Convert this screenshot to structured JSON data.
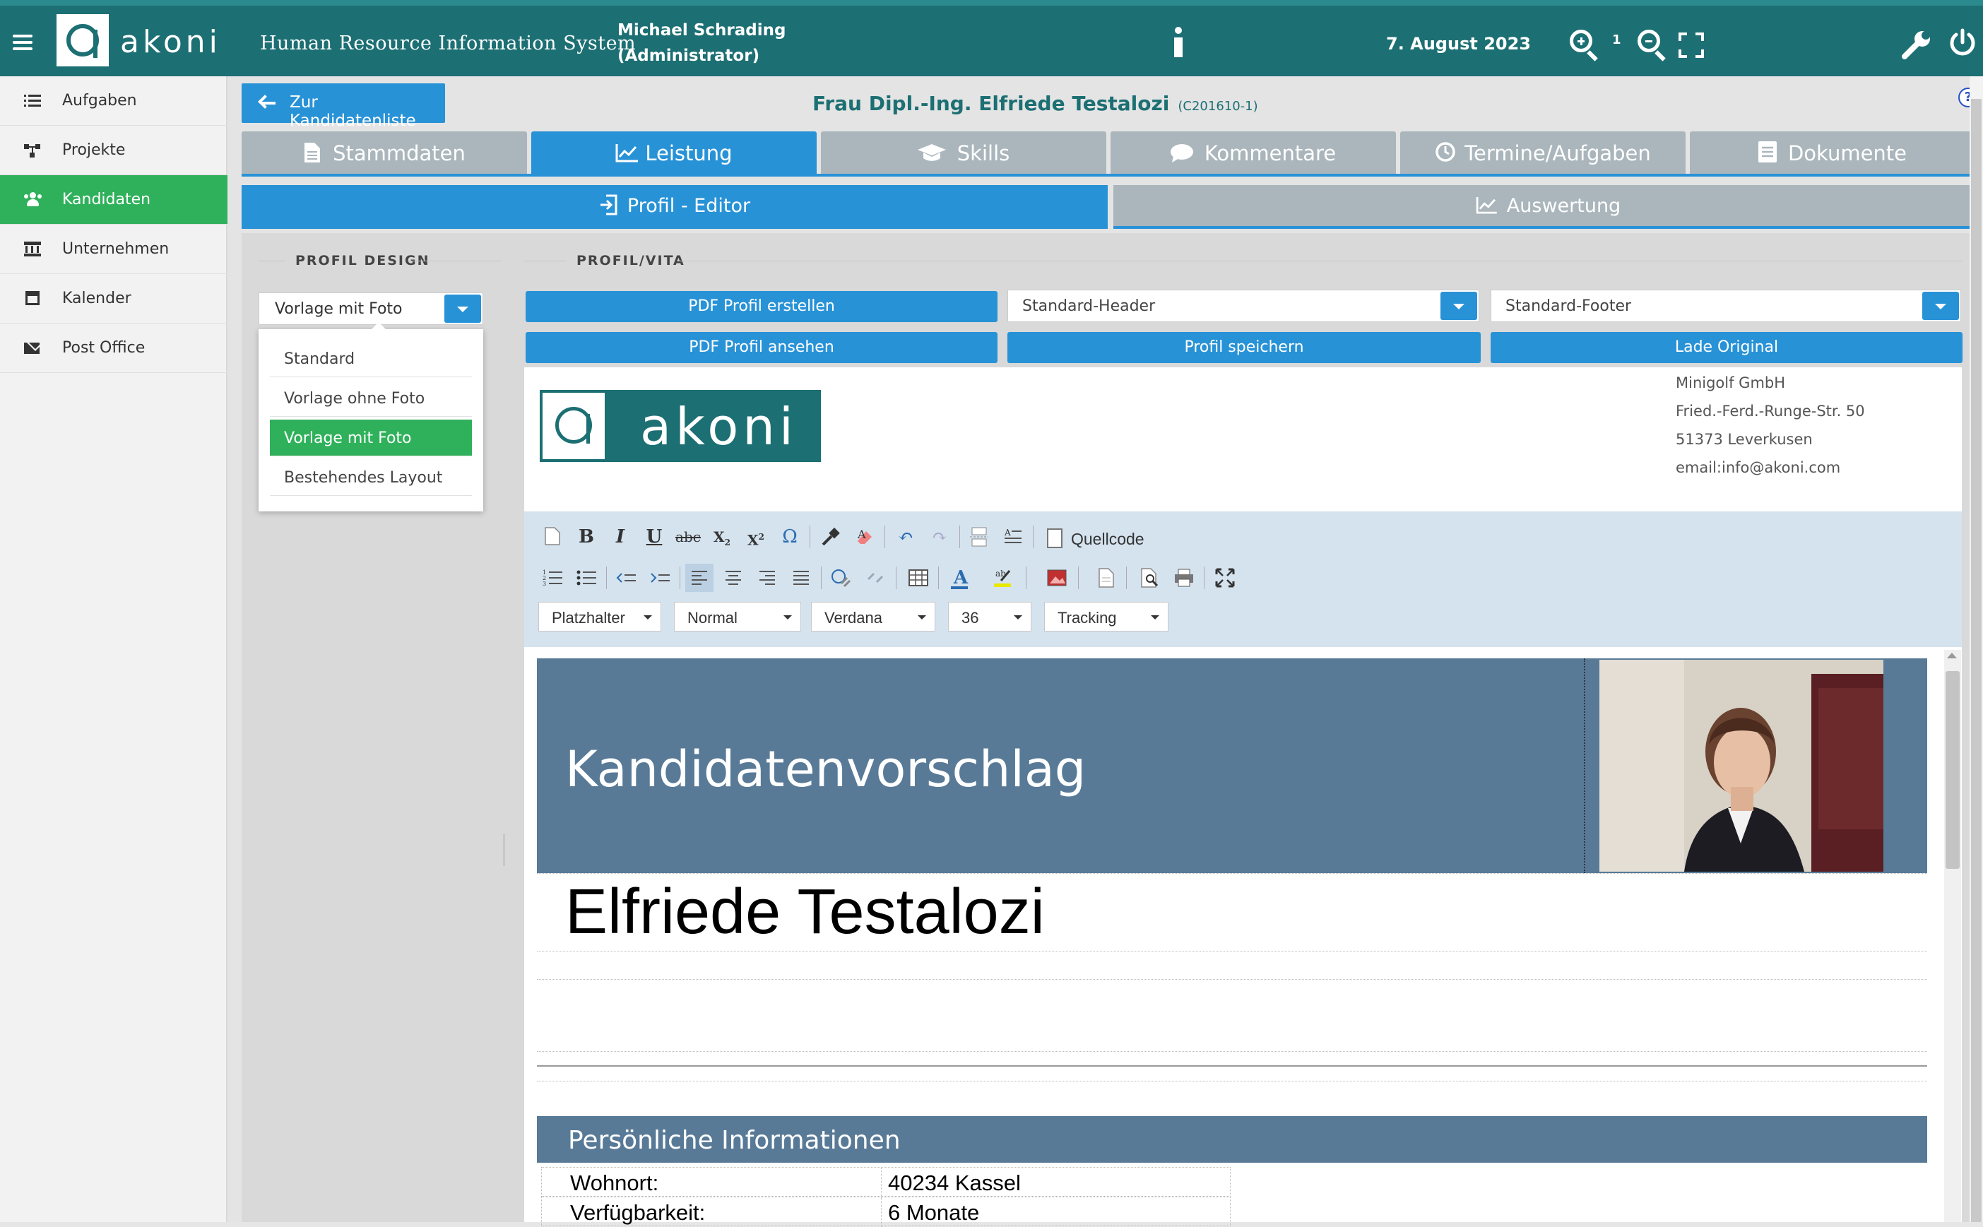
{
  "header": {
    "logo_text": "akoni",
    "system_title": "Human Resource Information System",
    "user_name": "Michael Schrading",
    "user_role": "(Administrator)",
    "date": "7. August 2023",
    "zoom_level": "1"
  },
  "sidebar": {
    "items": [
      {
        "label": "Aufgaben",
        "icon": "tasks-icon"
      },
      {
        "label": "Projekte",
        "icon": "sitemap-icon"
      },
      {
        "label": "Kandidaten",
        "icon": "users-icon",
        "active": true
      },
      {
        "label": "Unternehmen",
        "icon": "bank-icon"
      },
      {
        "label": "Kalender",
        "icon": "calendar-icon"
      },
      {
        "label": "Post Office",
        "icon": "envelope-icon"
      }
    ]
  },
  "page": {
    "back_label": "Zur Kandidatenliste",
    "candidate_title": "Frau Dipl.-Ing. Elfriede Testalozi",
    "candidate_id": "(C201610-1)",
    "help": "?"
  },
  "tabs": [
    {
      "label": "Stammdaten",
      "icon": "file-icon"
    },
    {
      "label": "Leistung",
      "icon": "chart-line-icon",
      "active": true
    },
    {
      "label": "Skills",
      "icon": "graduation-cap-icon"
    },
    {
      "label": "Kommentare",
      "icon": "comment-icon"
    },
    {
      "label": "Termine/Aufgaben",
      "icon": "clock-icon"
    },
    {
      "label": "Dokumente",
      "icon": "document-icon"
    }
  ],
  "subtabs": {
    "editor": "Profil - Editor",
    "auswertung": "Auswertung"
  },
  "profil_design": {
    "section_label": "PROFIL DESIGN",
    "selected": "Vorlage mit Foto",
    "options": [
      "Standard",
      "Vorlage ohne Foto",
      "Vorlage mit Foto",
      "Bestehendes Layout"
    ]
  },
  "profil_vita": {
    "section_label": "PROFIL/VITA",
    "btn_create_pdf": "PDF Profil erstellen",
    "btn_view_pdf": "PDF Profil ansehen",
    "btn_save": "Profil speichern",
    "btn_load_original": "Lade Original",
    "header_select": "Standard-Header",
    "footer_select": "Standard-Footer"
  },
  "doc_header": {
    "logo_text": "akoni",
    "company": "Minigolf GmbH",
    "street": "Fried.-Ferd.-Runge-Str. 50",
    "city": "51373 Leverkusen",
    "email": "email:info@akoni.com"
  },
  "editor_toolbar": {
    "source_label": "Quellcode",
    "placeholder_select": "Platzhalter",
    "format_select": "Normal",
    "font_select": "Verdana",
    "size_select": "36",
    "tracking_select": "Tracking"
  },
  "document": {
    "banner_title": "Kandidatenvorschlag",
    "candidate_name": "Elfriede Testalozi",
    "section_title": "Persönliche Informationen",
    "info_rows": [
      {
        "key": "Wohnort:",
        "value": "40234 Kassel"
      },
      {
        "key": "Verfügbarkeit:",
        "value": "6 Monate"
      }
    ]
  },
  "colors": {
    "topbar": "#1c6f73",
    "accent_blue": "#2892d7",
    "active_green": "#2fb15b",
    "banner": "#587a97",
    "tab_inactive": "#aab6bc"
  }
}
